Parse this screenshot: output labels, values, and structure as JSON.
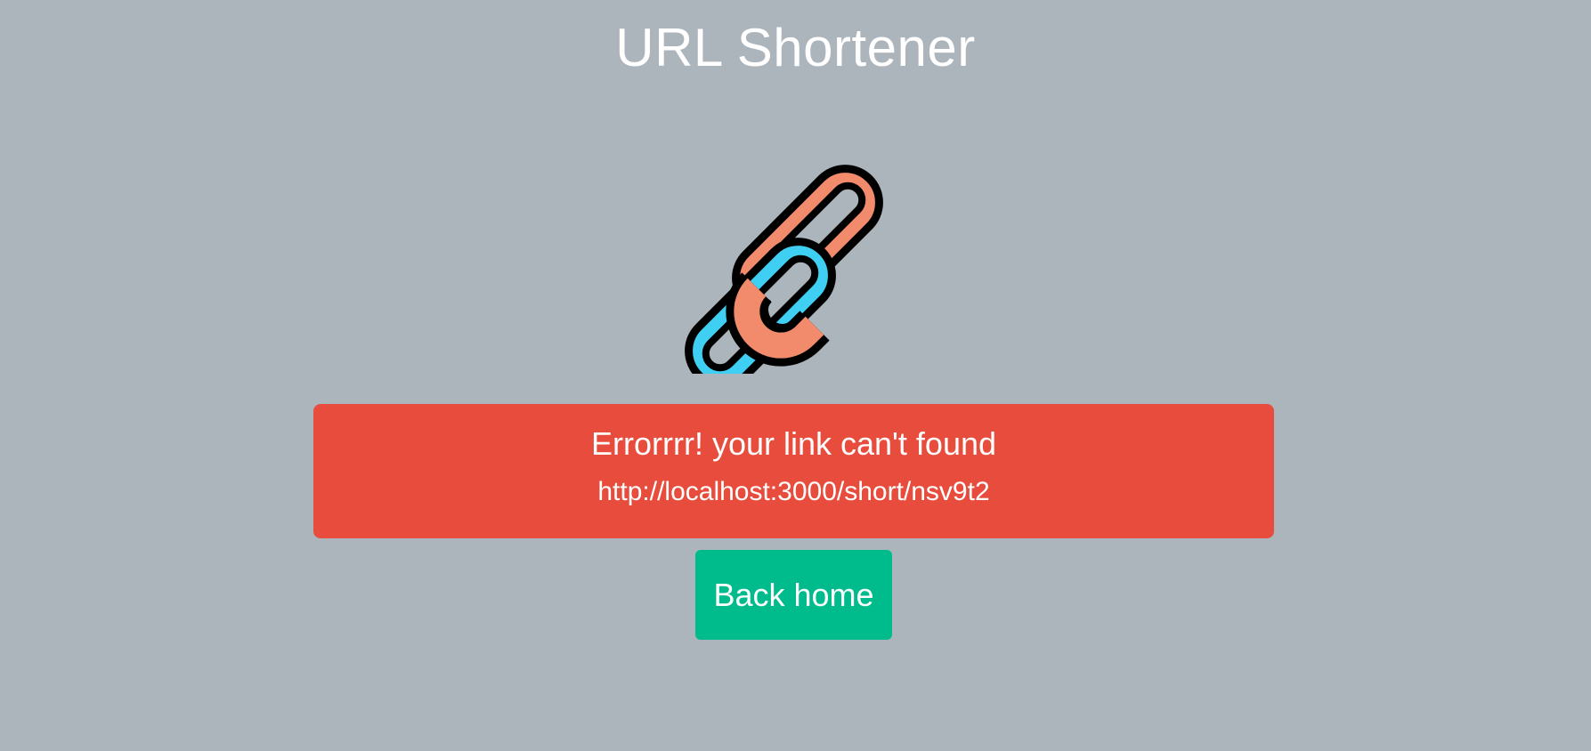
{
  "page": {
    "title": "URL Shortener",
    "logo_icon": "chain-link-icon"
  },
  "alert": {
    "message": "Errorrrr! your link can't found",
    "url": "http://localhost:3000/short/nsv9t2",
    "color": "#e74c3c"
  },
  "actions": {
    "back_home_label": "Back home",
    "color": "#00bc8c"
  },
  "colors": {
    "background": "#acb4bc",
    "link_orange": "#f28b6b",
    "link_blue": "#3fcff2"
  }
}
